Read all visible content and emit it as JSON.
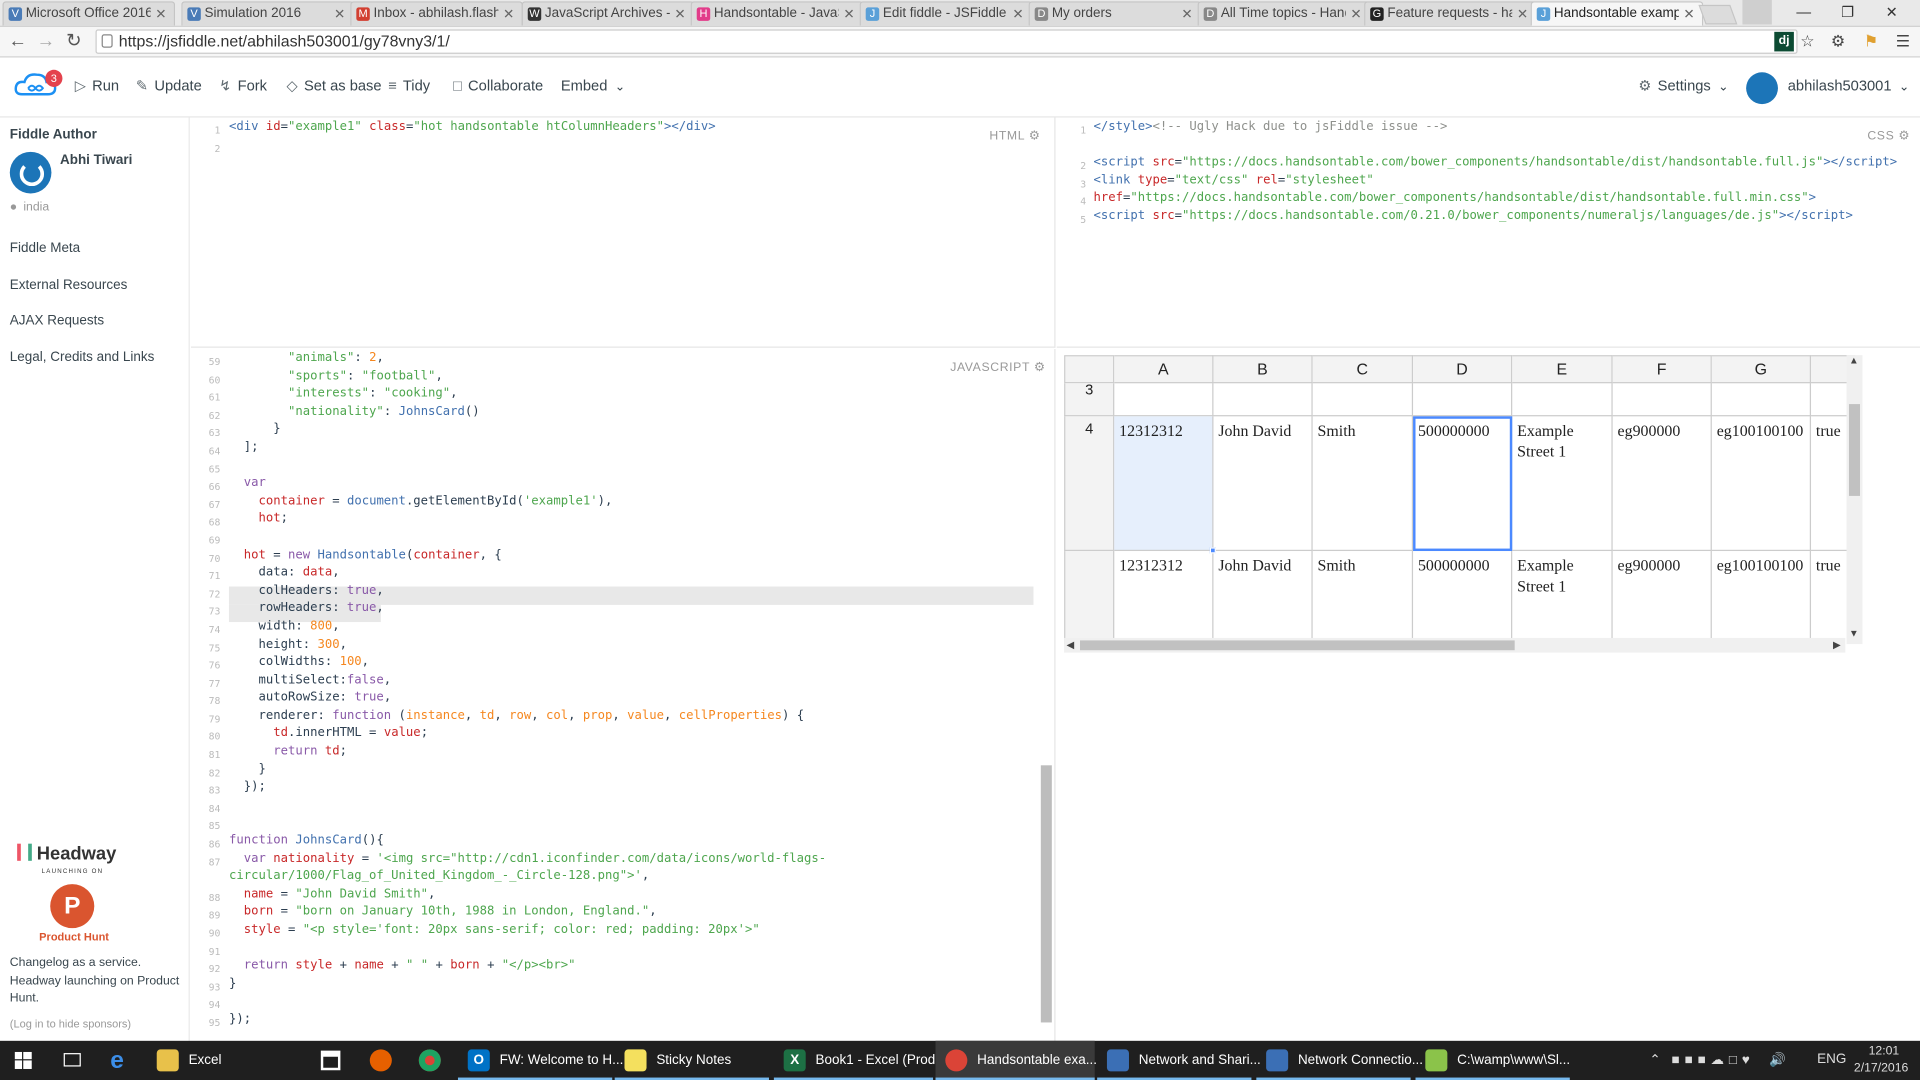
{
  "browser": {
    "tabs": [
      {
        "label": "Microsoft Office 2016",
        "icon": "V",
        "color": "#4a7bb7"
      },
      {
        "label": "Simulation 2016",
        "icon": "V",
        "color": "#4a7bb7"
      },
      {
        "label": "Inbox - abhilash.flash",
        "icon": "M",
        "color": "#d23f31"
      },
      {
        "label": "JavaScript Archives - R",
        "icon": "W",
        "color": "#333333"
      },
      {
        "label": "Handsontable - JavaS",
        "icon": "H",
        "color": "#e23c8a"
      },
      {
        "label": "Edit fiddle - JSFiddle",
        "icon": "J",
        "color": "#5aa0d8"
      },
      {
        "label": "My orders",
        "icon": "D",
        "color": "#888888"
      },
      {
        "label": "All Time topics - Hand",
        "icon": "D",
        "color": "#888888"
      },
      {
        "label": "Feature requests - han",
        "icon": "G",
        "color": "#222222"
      },
      {
        "label": "Handsontable exampl",
        "icon": "J",
        "color": "#5aa0d8"
      }
    ],
    "url": "https://jsfiddle.net/abhilash503001/gy78vny3/1/"
  },
  "toolbar": {
    "badge": "3",
    "run": "Run",
    "update": "Update",
    "fork": "Fork",
    "set_base": "Set as base",
    "tidy": "Tidy",
    "collaborate": "Collaborate",
    "embed": "Embed",
    "settings": "Settings",
    "user": "abhilash503001"
  },
  "sidebar": {
    "author_heading": "Fiddle Author",
    "author_name": "Abhi Tiwari",
    "location": "india",
    "links": [
      "Fiddle Meta",
      "External Resources",
      "AJAX Requests",
      "Legal, Credits and Links"
    ],
    "sponsor": {
      "brand": "Headway",
      "launching": "LAUNCHING ON",
      "ph_letter": "P",
      "ph_name": "Product Hunt",
      "text": "Changelog as a service. Headway launching on Product Hunt.",
      "hide": "(Log in to hide sponsors)"
    }
  },
  "panels": {
    "html_label": "HTML",
    "css_label": "CSS",
    "js_label": "JAVASCRIPT"
  },
  "result": {
    "columns": [
      "A",
      "B",
      "C",
      "D",
      "E",
      "F",
      "G"
    ],
    "partial_row_header": "3",
    "rows": [
      {
        "header": "4",
        "cells": [
          "12312312",
          "John David",
          "Smith",
          "500000000",
          "Example Street 1",
          "eg900000",
          "eg100100100",
          "true"
        ]
      },
      {
        "header": "",
        "cells": [
          "12312312",
          "John David",
          "Smith",
          "500000000",
          "Example Street 1",
          "eg900000",
          "eg100100100",
          "true"
        ]
      }
    ]
  },
  "taskbar": {
    "items": [
      "Excel",
      "FW: Welcome to H...",
      "Sticky Notes",
      "Book1 - Excel (Prod...",
      "Handsontable exa...",
      "Network and Shari...",
      "Network Connectio...",
      "C:\\wamp\\www\\Sl..."
    ],
    "lang": "ENG",
    "time": "12:01",
    "date": "2/17/2016"
  }
}
